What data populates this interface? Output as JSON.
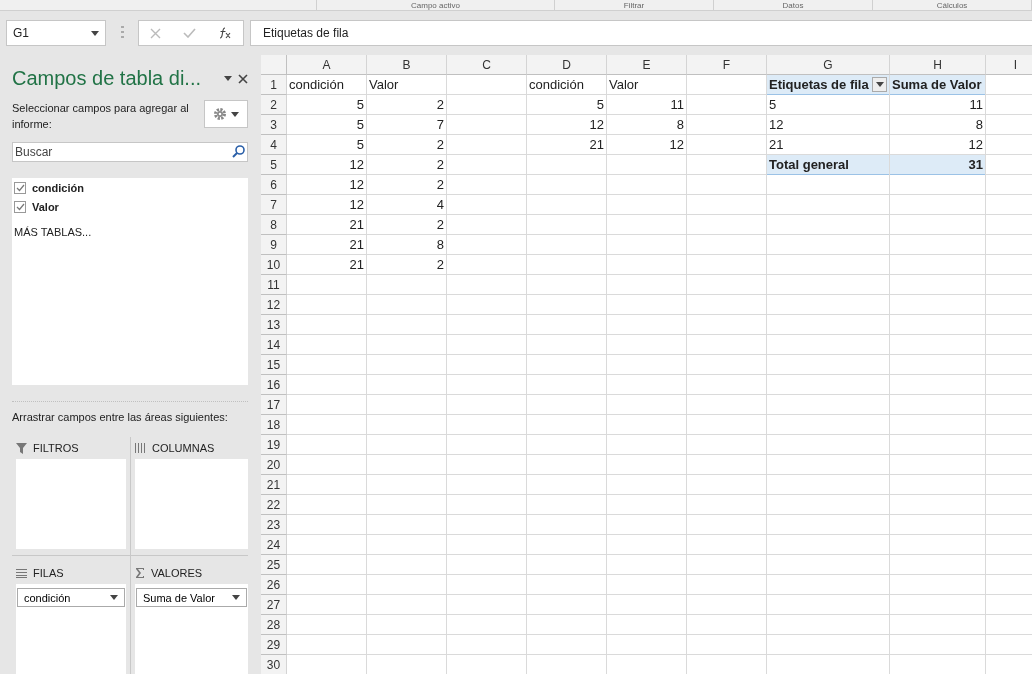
{
  "ribbon_groups": [
    "Campo activo",
    "Filtrar",
    "Datos",
    "Cálculos"
  ],
  "name_box": {
    "value": "G1"
  },
  "formula_bar": {
    "value": "Etiquetas de fila"
  },
  "pane": {
    "title": "Campos de tabla di...",
    "instruction": "Seleccionar campos para agregar al informe:",
    "search": {
      "placeholder": "Buscar"
    },
    "fields": [
      {
        "label": "condición",
        "checked": true
      },
      {
        "label": "Valor",
        "checked": true
      }
    ],
    "more_tables": "MÁS TABLAS...",
    "areas_hint": "Arrastrar campos entre las áreas siguientes:",
    "areas": [
      {
        "kind": "filter",
        "label": "FILTROS"
      },
      {
        "kind": "columns",
        "label": "COLUMNAS"
      },
      {
        "kind": "rows",
        "label": "FILAS",
        "items": [
          "condición"
        ]
      },
      {
        "kind": "values",
        "label": "VALORES",
        "items": [
          "Suma de Valor"
        ]
      }
    ]
  },
  "sheet": {
    "columns": [
      "A",
      "B",
      "C",
      "D",
      "E",
      "F",
      "G",
      "H",
      "I"
    ],
    "rows": [
      {
        "row": "1",
        "cells": {
          "A": {
            "value": "condición",
            "kind": "text"
          },
          "B": {
            "value": "Valor",
            "kind": "text"
          },
          "D": {
            "value": "condición",
            "kind": "text"
          },
          "E": {
            "value": "Valor",
            "kind": "text"
          },
          "G": {
            "value": "Etiquetas de fila",
            "kind": "pivot-header-filter"
          },
          "H": {
            "value": "Suma de Valor",
            "kind": "pivot-header"
          }
        }
      },
      {
        "row": "2",
        "cells": {
          "A": {
            "value": "5",
            "kind": "number"
          },
          "B": {
            "value": "2",
            "kind": "number"
          },
          "D": {
            "value": "5",
            "kind": "number"
          },
          "E": {
            "value": "11",
            "kind": "number"
          },
          "G": {
            "value": "5",
            "kind": "pivot-label"
          },
          "H": {
            "value": "11",
            "kind": "number"
          }
        }
      },
      {
        "row": "3",
        "cells": {
          "A": {
            "value": "5",
            "kind": "number"
          },
          "B": {
            "value": "7",
            "kind": "number"
          },
          "D": {
            "value": "12",
            "kind": "number"
          },
          "E": {
            "value": "8",
            "kind": "number"
          },
          "G": {
            "value": "12",
            "kind": "pivot-label"
          },
          "H": {
            "value": "8",
            "kind": "number"
          }
        }
      },
      {
        "row": "4",
        "cells": {
          "A": {
            "value": "5",
            "kind": "number"
          },
          "B": {
            "value": "2",
            "kind": "number"
          },
          "D": {
            "value": "21",
            "kind": "number"
          },
          "E": {
            "value": "12",
            "kind": "number"
          },
          "G": {
            "value": "21",
            "kind": "pivot-label"
          },
          "H": {
            "value": "12",
            "kind": "number"
          }
        }
      },
      {
        "row": "5",
        "cells": {
          "A": {
            "value": "12",
            "kind": "number"
          },
          "B": {
            "value": "2",
            "kind": "number"
          },
          "G": {
            "value": "Total general",
            "kind": "pivot-total-label"
          },
          "H": {
            "value": "31",
            "kind": "pivot-total-value"
          }
        }
      },
      {
        "row": "6",
        "cells": {
          "A": {
            "value": "12",
            "kind": "number"
          },
          "B": {
            "value": "2",
            "kind": "number"
          }
        }
      },
      {
        "row": "7",
        "cells": {
          "A": {
            "value": "12",
            "kind": "number"
          },
          "B": {
            "value": "4",
            "kind": "number"
          }
        }
      },
      {
        "row": "8",
        "cells": {
          "A": {
            "value": "21",
            "kind": "number"
          },
          "B": {
            "value": "2",
            "kind": "number"
          }
        }
      },
      {
        "row": "9",
        "cells": {
          "A": {
            "value": "21",
            "kind": "number"
          },
          "B": {
            "value": "8",
            "kind": "number"
          }
        }
      },
      {
        "row": "10",
        "cells": {
          "A": {
            "value": "21",
            "kind": "number"
          },
          "B": {
            "value": "2",
            "kind": "number"
          }
        }
      },
      {
        "row": "11"
      },
      {
        "row": "12"
      },
      {
        "row": "13"
      },
      {
        "row": "14"
      },
      {
        "row": "15"
      },
      {
        "row": "16"
      },
      {
        "row": "17"
      },
      {
        "row": "18"
      },
      {
        "row": "19"
      },
      {
        "row": "20"
      },
      {
        "row": "21"
      },
      {
        "row": "22"
      },
      {
        "row": "23"
      },
      {
        "row": "24"
      },
      {
        "row": "25"
      },
      {
        "row": "26"
      },
      {
        "row": "27"
      },
      {
        "row": "28"
      },
      {
        "row": "29"
      },
      {
        "row": "30"
      }
    ]
  }
}
